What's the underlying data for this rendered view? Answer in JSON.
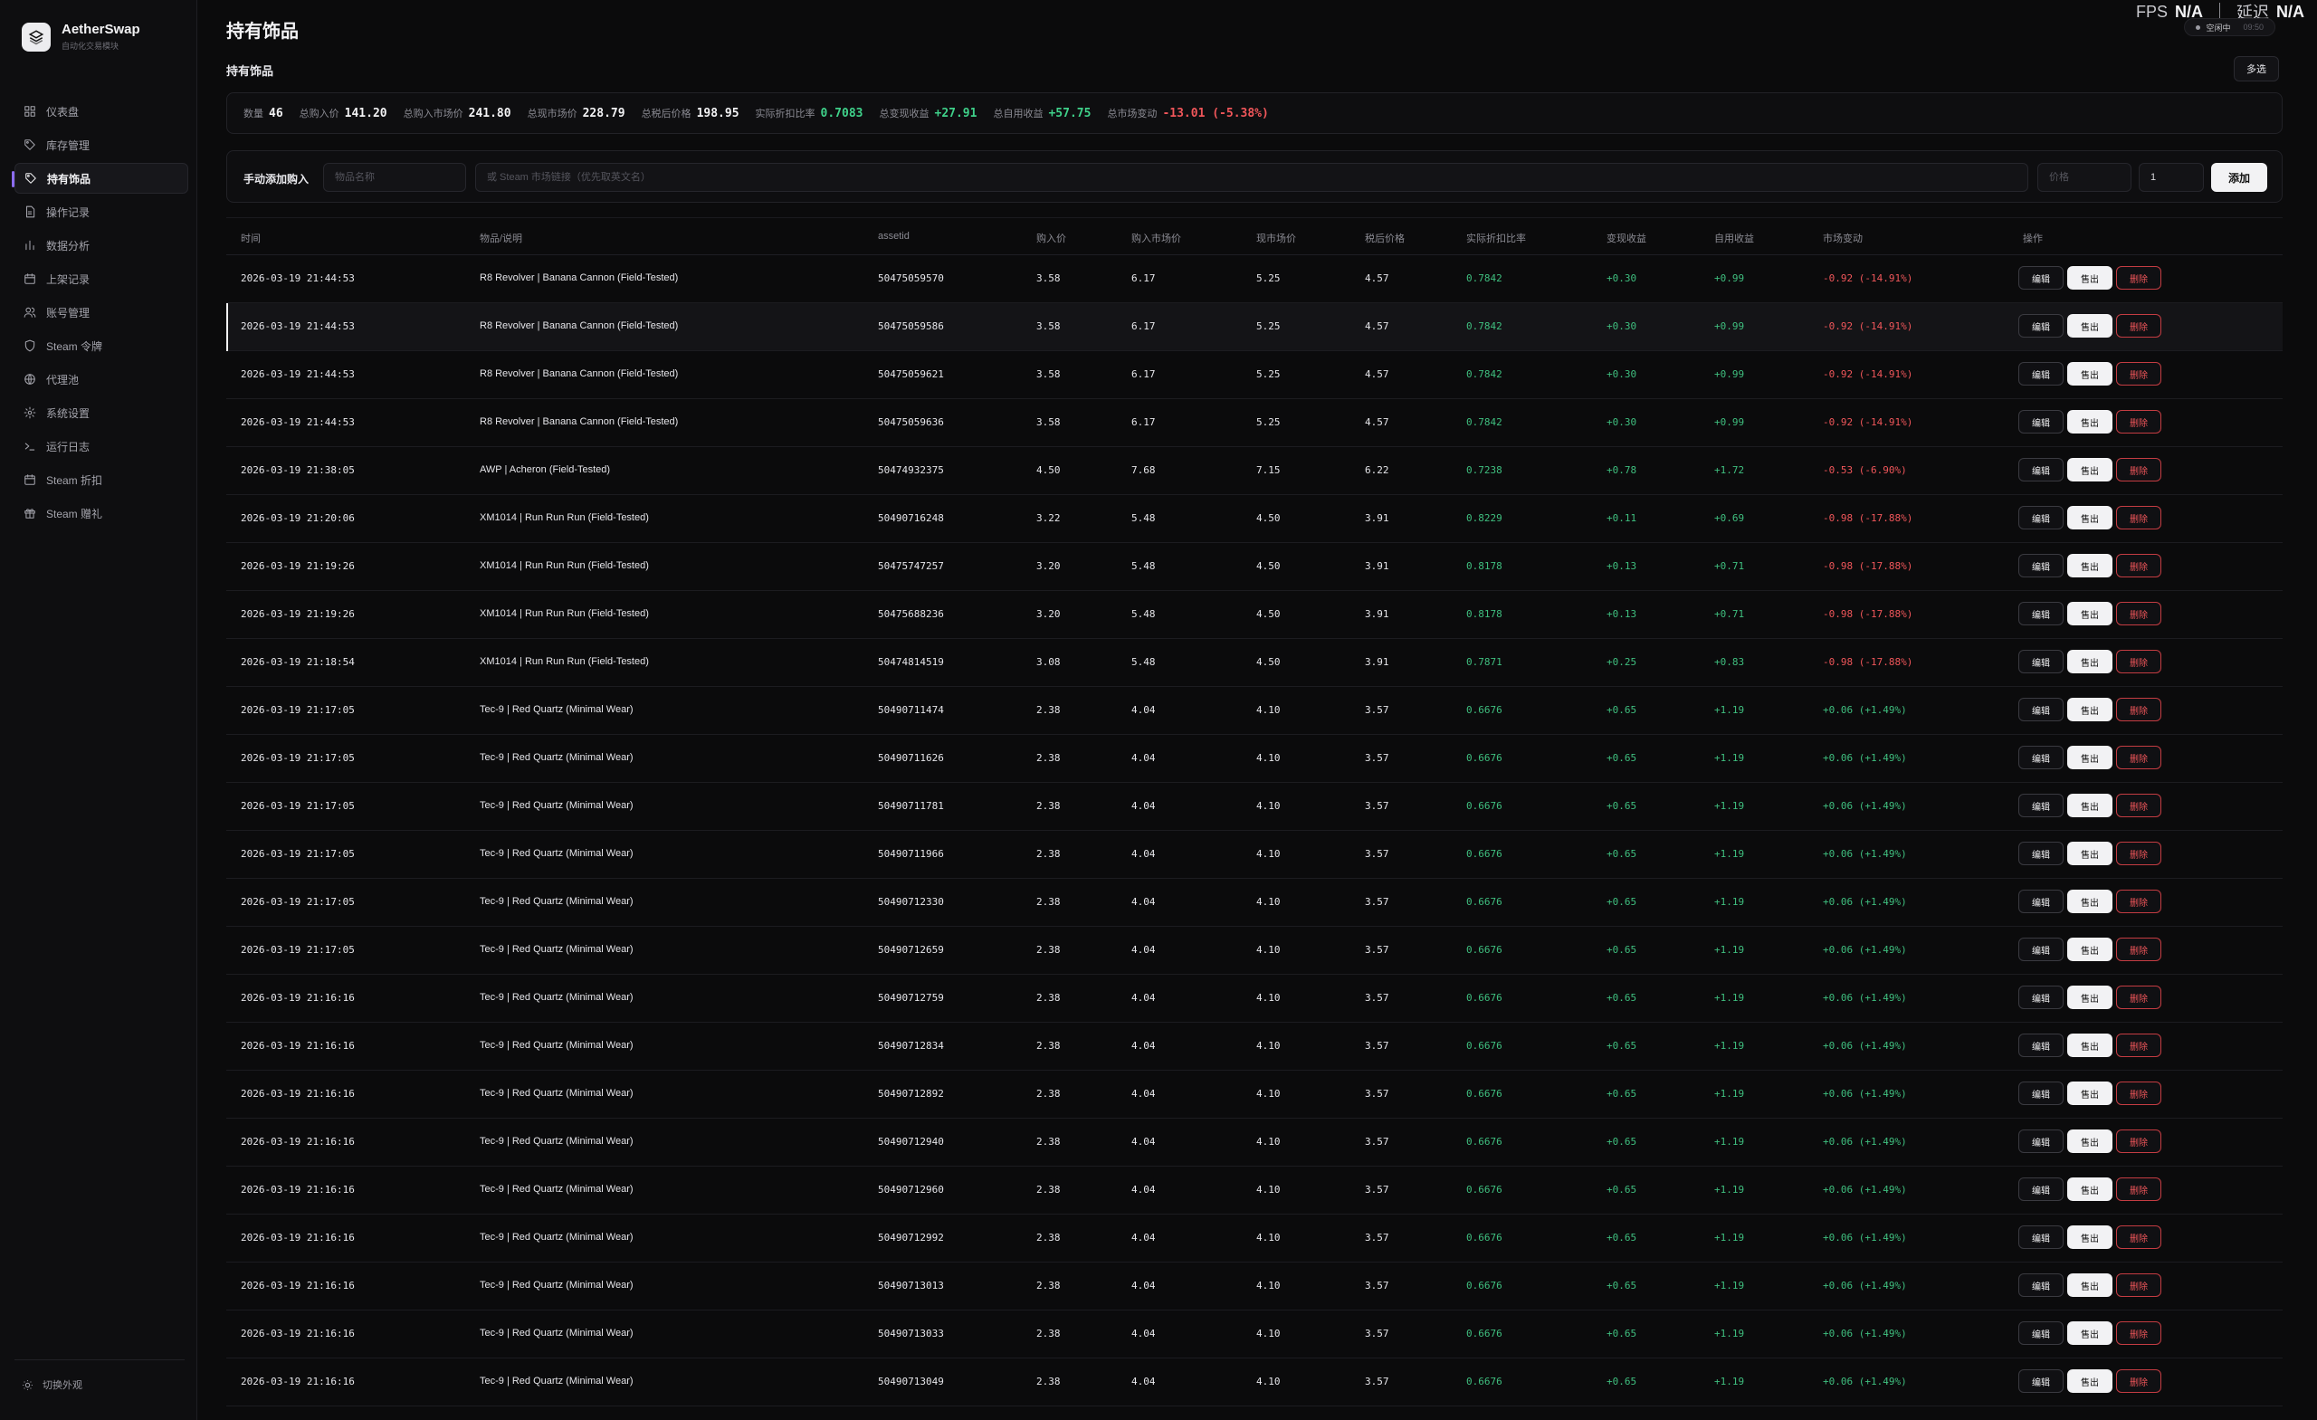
{
  "brand": {
    "name": "AetherSwap",
    "subtitle": "自动化交易模块"
  },
  "nav": [
    {
      "label": "仪表盘",
      "icon": "dashboard-icon"
    },
    {
      "label": "库存管理",
      "icon": "tag-icon"
    },
    {
      "label": "持有饰品",
      "icon": "tag-icon",
      "active": true
    },
    {
      "label": "操作记录",
      "icon": "document-icon"
    },
    {
      "label": "数据分析",
      "icon": "bar-chart-icon"
    },
    {
      "label": "上架记录",
      "icon": "calendar-icon"
    },
    {
      "label": "账号管理",
      "icon": "users-icon"
    },
    {
      "label": "Steam 令牌",
      "icon": "shield-icon"
    },
    {
      "label": "代理池",
      "icon": "globe-icon"
    },
    {
      "label": "系统设置",
      "icon": "gear-icon"
    },
    {
      "label": "运行日志",
      "icon": "terminal-icon"
    },
    {
      "label": "Steam 折扣",
      "icon": "calendar-icon"
    },
    {
      "label": "Steam 赠礼",
      "icon": "gift-icon"
    }
  ],
  "theme_toggle": "切换外观",
  "header": {
    "title": "持有饰品",
    "fps_label": "FPS",
    "fps_value": "N/A",
    "latency_label": "延迟",
    "latency_value": "N/A",
    "status": "空闲中",
    "status_time": "09:50"
  },
  "section_label": "持有饰品",
  "multi_select": "多选",
  "stats": [
    {
      "label": "数量",
      "value": "46",
      "tone": ""
    },
    {
      "label": "总购入价",
      "value": "141.20",
      "tone": ""
    },
    {
      "label": "总购入市场价",
      "value": "241.80",
      "tone": ""
    },
    {
      "label": "总现市场价",
      "value": "228.79",
      "tone": ""
    },
    {
      "label": "总税后价格",
      "value": "198.95",
      "tone": ""
    },
    {
      "label": "实际折扣比率",
      "value": "0.7083",
      "tone": "g"
    },
    {
      "label": "总变现收益",
      "value": "+27.91",
      "tone": "g"
    },
    {
      "label": "总自用收益",
      "value": "+57.75",
      "tone": "g"
    },
    {
      "label": "总市场变动",
      "value": "-13.01 (-5.38%)",
      "tone": "r"
    }
  ],
  "add_form": {
    "label": "手动添加购入",
    "name_placeholder": "物品名称",
    "link_placeholder": "或 Steam 市场链接（优先取英文名）",
    "price_placeholder": "价格",
    "qty_value": "1",
    "submit": "添加"
  },
  "columns": [
    "时间",
    "物品/说明",
    "assetid",
    "购入价",
    "购入市场价",
    "现市场价",
    "税后价格",
    "实际折扣比率",
    "变现收益",
    "自用收益",
    "市场变动",
    "操作"
  ],
  "actions": {
    "edit": "编辑",
    "sell": "售出",
    "delete": "删除"
  },
  "rows": [
    [
      "2026-03-19 21:44:53",
      "R8 Revolver | Banana Cannon (Field-Tested)",
      "50475059570",
      "3.58",
      "6.17",
      "5.25",
      "4.57",
      "0.7842",
      "+0.30",
      "+0.99",
      "-0.92 (-14.91%)"
    ],
    [
      "2026-03-19 21:44:53",
      "R8 Revolver | Banana Cannon (Field-Tested)",
      "50475059586",
      "3.58",
      "6.17",
      "5.25",
      "4.57",
      "0.7842",
      "+0.30",
      "+0.99",
      "-0.92 (-14.91%)"
    ],
    [
      "2026-03-19 21:44:53",
      "R8 Revolver | Banana Cannon (Field-Tested)",
      "50475059621",
      "3.58",
      "6.17",
      "5.25",
      "4.57",
      "0.7842",
      "+0.30",
      "+0.99",
      "-0.92 (-14.91%)"
    ],
    [
      "2026-03-19 21:44:53",
      "R8 Revolver | Banana Cannon (Field-Tested)",
      "50475059636",
      "3.58",
      "6.17",
      "5.25",
      "4.57",
      "0.7842",
      "+0.30",
      "+0.99",
      "-0.92 (-14.91%)"
    ],
    [
      "2026-03-19 21:38:05",
      "AWP | Acheron (Field-Tested)",
      "50474932375",
      "4.50",
      "7.68",
      "7.15",
      "6.22",
      "0.7238",
      "+0.78",
      "+1.72",
      "-0.53 (-6.90%)"
    ],
    [
      "2026-03-19 21:20:06",
      "XM1014 | Run Run Run (Field-Tested)",
      "50490716248",
      "3.22",
      "5.48",
      "4.50",
      "3.91",
      "0.8229",
      "+0.11",
      "+0.69",
      "-0.98 (-17.88%)"
    ],
    [
      "2026-03-19 21:19:26",
      "XM1014 | Run Run Run (Field-Tested)",
      "50475747257",
      "3.20",
      "5.48",
      "4.50",
      "3.91",
      "0.8178",
      "+0.13",
      "+0.71",
      "-0.98 (-17.88%)"
    ],
    [
      "2026-03-19 21:19:26",
      "XM1014 | Run Run Run (Field-Tested)",
      "50475688236",
      "3.20",
      "5.48",
      "4.50",
      "3.91",
      "0.8178",
      "+0.13",
      "+0.71",
      "-0.98 (-17.88%)"
    ],
    [
      "2026-03-19 21:18:54",
      "XM1014 | Run Run Run (Field-Tested)",
      "50474814519",
      "3.08",
      "5.48",
      "4.50",
      "3.91",
      "0.7871",
      "+0.25",
      "+0.83",
      "-0.98 (-17.88%)"
    ],
    [
      "2026-03-19 21:17:05",
      "Tec-9 | Red Quartz (Minimal Wear)",
      "50490711474",
      "2.38",
      "4.04",
      "4.10",
      "3.57",
      "0.6676",
      "+0.65",
      "+1.19",
      "+0.06 (+1.49%)"
    ],
    [
      "2026-03-19 21:17:05",
      "Tec-9 | Red Quartz (Minimal Wear)",
      "50490711626",
      "2.38",
      "4.04",
      "4.10",
      "3.57",
      "0.6676",
      "+0.65",
      "+1.19",
      "+0.06 (+1.49%)"
    ],
    [
      "2026-03-19 21:17:05",
      "Tec-9 | Red Quartz (Minimal Wear)",
      "50490711781",
      "2.38",
      "4.04",
      "4.10",
      "3.57",
      "0.6676",
      "+0.65",
      "+1.19",
      "+0.06 (+1.49%)"
    ],
    [
      "2026-03-19 21:17:05",
      "Tec-9 | Red Quartz (Minimal Wear)",
      "50490711966",
      "2.38",
      "4.04",
      "4.10",
      "3.57",
      "0.6676",
      "+0.65",
      "+1.19",
      "+0.06 (+1.49%)"
    ],
    [
      "2026-03-19 21:17:05",
      "Tec-9 | Red Quartz (Minimal Wear)",
      "50490712330",
      "2.38",
      "4.04",
      "4.10",
      "3.57",
      "0.6676",
      "+0.65",
      "+1.19",
      "+0.06 (+1.49%)"
    ],
    [
      "2026-03-19 21:17:05",
      "Tec-9 | Red Quartz (Minimal Wear)",
      "50490712659",
      "2.38",
      "4.04",
      "4.10",
      "3.57",
      "0.6676",
      "+0.65",
      "+1.19",
      "+0.06 (+1.49%)"
    ],
    [
      "2026-03-19 21:16:16",
      "Tec-9 | Red Quartz (Minimal Wear)",
      "50490712759",
      "2.38",
      "4.04",
      "4.10",
      "3.57",
      "0.6676",
      "+0.65",
      "+1.19",
      "+0.06 (+1.49%)"
    ],
    [
      "2026-03-19 21:16:16",
      "Tec-9 | Red Quartz (Minimal Wear)",
      "50490712834",
      "2.38",
      "4.04",
      "4.10",
      "3.57",
      "0.6676",
      "+0.65",
      "+1.19",
      "+0.06 (+1.49%)"
    ],
    [
      "2026-03-19 21:16:16",
      "Tec-9 | Red Quartz (Minimal Wear)",
      "50490712892",
      "2.38",
      "4.04",
      "4.10",
      "3.57",
      "0.6676",
      "+0.65",
      "+1.19",
      "+0.06 (+1.49%)"
    ],
    [
      "2026-03-19 21:16:16",
      "Tec-9 | Red Quartz (Minimal Wear)",
      "50490712940",
      "2.38",
      "4.04",
      "4.10",
      "3.57",
      "0.6676",
      "+0.65",
      "+1.19",
      "+0.06 (+1.49%)"
    ],
    [
      "2026-03-19 21:16:16",
      "Tec-9 | Red Quartz (Minimal Wear)",
      "50490712960",
      "2.38",
      "4.04",
      "4.10",
      "3.57",
      "0.6676",
      "+0.65",
      "+1.19",
      "+0.06 (+1.49%)"
    ],
    [
      "2026-03-19 21:16:16",
      "Tec-9 | Red Quartz (Minimal Wear)",
      "50490712992",
      "2.38",
      "4.04",
      "4.10",
      "3.57",
      "0.6676",
      "+0.65",
      "+1.19",
      "+0.06 (+1.49%)"
    ],
    [
      "2026-03-19 21:16:16",
      "Tec-9 | Red Quartz (Minimal Wear)",
      "50490713013",
      "2.38",
      "4.04",
      "4.10",
      "3.57",
      "0.6676",
      "+0.65",
      "+1.19",
      "+0.06 (+1.49%)"
    ],
    [
      "2026-03-19 21:16:16",
      "Tec-9 | Red Quartz (Minimal Wear)",
      "50490713033",
      "2.38",
      "4.04",
      "4.10",
      "3.57",
      "0.6676",
      "+0.65",
      "+1.19",
      "+0.06 (+1.49%)"
    ],
    [
      "2026-03-19 21:16:16",
      "Tec-9 | Red Quartz (Minimal Wear)",
      "50490713049",
      "2.38",
      "4.04",
      "4.10",
      "3.57",
      "0.6676",
      "+0.65",
      "+1.19",
      "+0.06 (+1.49%)"
    ]
  ],
  "highlighted_row": 1,
  "colors": {
    "positive": "#3fbf7f",
    "negative": "#f0565a",
    "accent": "#8c6cf0"
  }
}
